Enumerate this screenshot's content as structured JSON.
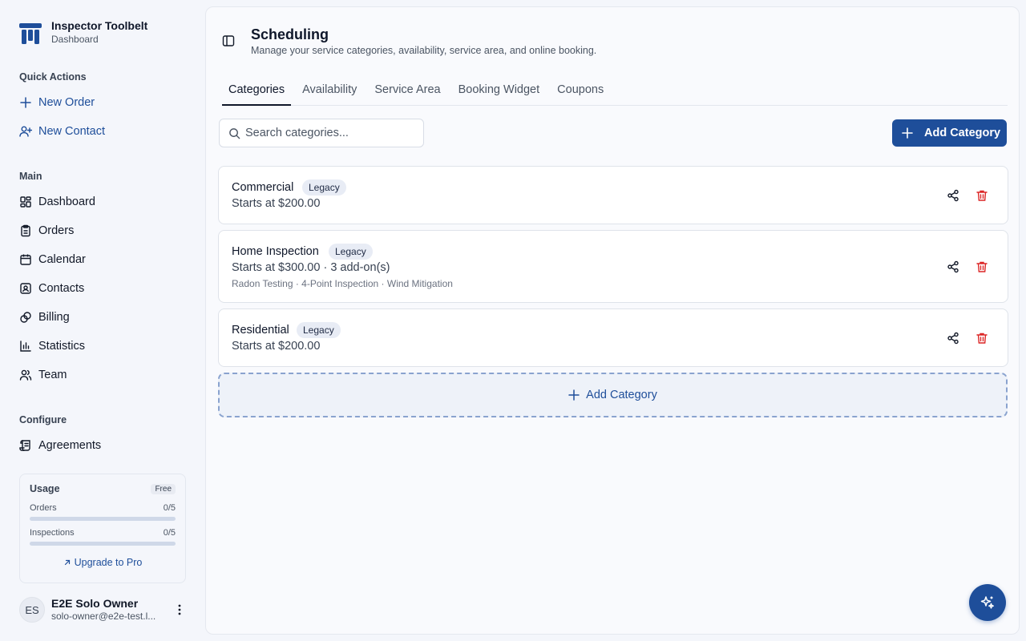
{
  "app": {
    "title": "Inspector Toolbelt",
    "subtitle": "Dashboard"
  },
  "sidebar": {
    "quick_actions_label": "Quick Actions",
    "quick_actions": [
      {
        "label": "New Order",
        "icon": "plus-icon"
      },
      {
        "label": "New Contact",
        "icon": "user-plus-icon"
      }
    ],
    "main_label": "Main",
    "main_items": [
      {
        "label": "Dashboard",
        "icon": "grid-icon"
      },
      {
        "label": "Orders",
        "icon": "clipboard-icon"
      },
      {
        "label": "Calendar",
        "icon": "calendar-icon"
      },
      {
        "label": "Contacts",
        "icon": "contact-card-icon"
      },
      {
        "label": "Billing",
        "icon": "coins-icon"
      },
      {
        "label": "Statistics",
        "icon": "bar-chart-icon"
      },
      {
        "label": "Team",
        "icon": "users-icon"
      }
    ],
    "configure_label": "Configure",
    "configure_items": [
      {
        "label": "Agreements",
        "icon": "scroll-icon"
      }
    ],
    "usage": {
      "title": "Usage",
      "plan": "Free",
      "rows": [
        {
          "label": "Orders",
          "value": "0/5",
          "fraction": 0
        },
        {
          "label": "Inspections",
          "value": "0/5",
          "fraction": 0
        }
      ],
      "upgrade_label": "Upgrade to Pro"
    },
    "user": {
      "initials": "ES",
      "name": "E2E Solo Owner",
      "email": "solo-owner@e2e-test.l..."
    }
  },
  "page": {
    "title": "Scheduling",
    "description": "Manage your service categories, availability, service area, and online booking.",
    "tabs": [
      {
        "label": "Categories",
        "active": true
      },
      {
        "label": "Availability",
        "active": false
      },
      {
        "label": "Service Area",
        "active": false
      },
      {
        "label": "Booking Widget",
        "active": false
      },
      {
        "label": "Coupons",
        "active": false
      }
    ],
    "search": {
      "placeholder": "Search categories...",
      "value": ""
    },
    "add_button_label": "Add Category",
    "categories": [
      {
        "name": "Commercial",
        "badge": "Legacy",
        "price": "Starts at $200.00",
        "addons": ""
      },
      {
        "name": "Home Inspection",
        "badge": "Legacy",
        "price": "Starts at $300.00 · 3 add-on(s)",
        "addons": "Radon Testing · 4-Point Inspection · Wind Mitigation"
      },
      {
        "name": "Residential",
        "badge": "Legacy",
        "price": "Starts at $200.00",
        "addons": ""
      }
    ],
    "add_dashed_label": "Add Category"
  },
  "colors": {
    "accent": "#1e4e9a",
    "danger": "#dc2626",
    "background": "#f4f6fb"
  }
}
